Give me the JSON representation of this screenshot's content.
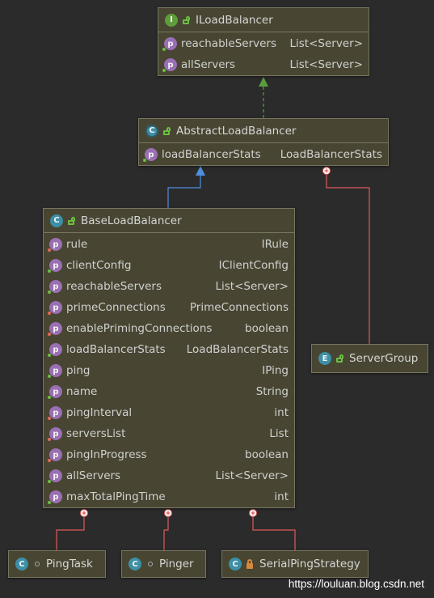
{
  "colors": {
    "background": "#2b2b2b",
    "node_fill": "#484632",
    "node_border": "#77765f",
    "implements_edge": "#5a9c3f",
    "extends_edge": "#4f8fe0",
    "inner_edge": "#e05a5a"
  },
  "nodes": {
    "iloadbalancer": {
      "kind": "interface",
      "badge": "I",
      "visibility_icon": "lock-open-icon",
      "title": "ILoadBalancer",
      "fields": [
        {
          "name": "reachableServers",
          "type": "List<Server>"
        },
        {
          "name": "allServers",
          "type": "List<Server>"
        }
      ]
    },
    "abstractloadbalancer": {
      "kind": "abstract-class",
      "badge": "C",
      "visibility_icon": "lock-open-icon",
      "title": "AbstractLoadBalancer",
      "fields": [
        {
          "name": "loadBalancerStats",
          "type": "LoadBalancerStats"
        }
      ]
    },
    "baseloadbalancer": {
      "kind": "class",
      "badge": "C",
      "visibility_icon": "lock-open-icon",
      "title": "BaseLoadBalancer",
      "fields": [
        {
          "name": "rule",
          "type": "IRule"
        },
        {
          "name": "clientConfig",
          "type": "IClientConfig"
        },
        {
          "name": "reachableServers",
          "type": "List<Server>"
        },
        {
          "name": "primeConnections",
          "type": "PrimeConnections"
        },
        {
          "name": "enablePrimingConnections",
          "type": "boolean"
        },
        {
          "name": "loadBalancerStats",
          "type": "LoadBalancerStats"
        },
        {
          "name": "ping",
          "type": "IPing"
        },
        {
          "name": "name",
          "type": "String"
        },
        {
          "name": "pingInterval",
          "type": "int"
        },
        {
          "name": "serversList",
          "type": "List"
        },
        {
          "name": "pingInProgress",
          "type": "boolean"
        },
        {
          "name": "allServers",
          "type": "List<Server>"
        },
        {
          "name": "maxTotalPingTime",
          "type": "int"
        }
      ]
    },
    "servergroup": {
      "kind": "enum",
      "badge": "E",
      "visibility_icon": "lock-open-icon",
      "title": "ServerGroup"
    },
    "pingtask": {
      "kind": "class",
      "badge": "C",
      "visibility_icon": "package-private-icon",
      "title": "PingTask"
    },
    "pinger": {
      "kind": "class",
      "badge": "C",
      "visibility_icon": "package-private-icon",
      "title": "Pinger"
    },
    "serialpingstrategy": {
      "kind": "class",
      "badge": "C",
      "visibility_icon": "lock-closed-icon",
      "title": "SerialPingStrategy"
    }
  },
  "edges": [
    {
      "from": "abstractloadbalancer",
      "to": "iloadbalancer",
      "kind": "implements"
    },
    {
      "from": "baseloadbalancer",
      "to": "abstractloadbalancer",
      "kind": "extends"
    },
    {
      "from": "servergroup",
      "to": "abstractloadbalancer",
      "kind": "inner-class"
    },
    {
      "from": "pingtask",
      "to": "baseloadbalancer",
      "kind": "inner-class"
    },
    {
      "from": "pinger",
      "to": "baseloadbalancer",
      "kind": "inner-class"
    },
    {
      "from": "serialpingstrategy",
      "to": "baseloadbalancer",
      "kind": "inner-class"
    }
  ],
  "field_badge": "p",
  "watermark": "https://louluan.blog.csdn.net"
}
